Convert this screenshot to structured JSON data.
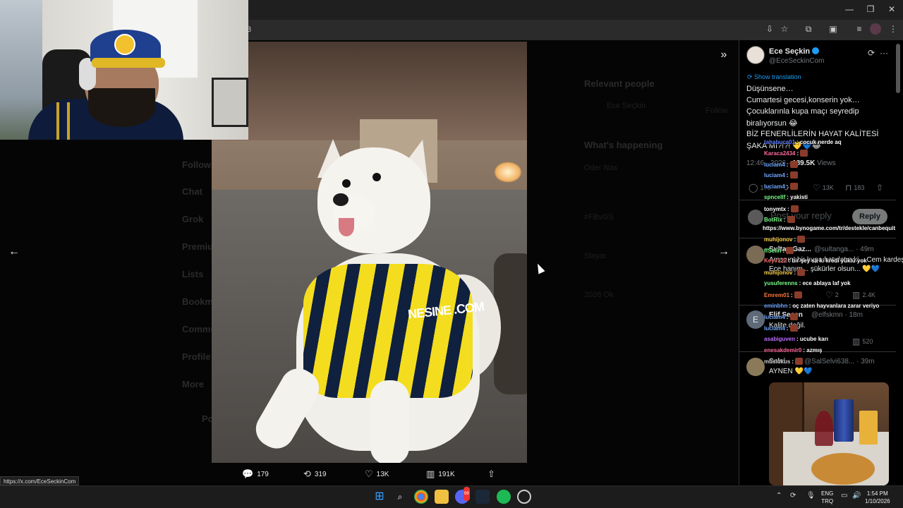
{
  "browser": {
    "address_fragment": "3",
    "status_url": "https://x.com/EceSeckinCom",
    "window_controls": {
      "minimize": "—",
      "restore": "❐",
      "close": "✕"
    }
  },
  "background_page": {
    "nav_items": [
      "Follow",
      "Chat",
      "Grok",
      "Premium",
      "Lists",
      "Bookmarks",
      "Communities",
      "Profile",
      "More"
    ],
    "post_label": "Post",
    "relevant_people": "Relevant people",
    "relevant_person": "Ece Seçkin",
    "follow_label": "Follow",
    "whats_happening": "What's happening",
    "trends": [
      "Oder Nas",
      "#FBvGS",
      "Slayar",
      "2026 Ok"
    ]
  },
  "media": {
    "jersey_text": "NESINE .COM",
    "stats": {
      "replies": "179",
      "reposts": "319",
      "likes": "13K",
      "views": "191K"
    }
  },
  "panel": {
    "author": {
      "name": "Ece Seçkin",
      "handle": "@EceSeckinCom"
    },
    "show_translation": "Show translation",
    "tweet_lines": [
      "Düşünsene…",
      "Cumartesi gecesi,konserin yok…",
      "Çocuklarınla kupa maçı seyredip",
      "biralıyorsun 😂",
      "BİZ FENERLİLERİN HAYAT KALİTESİ",
      "ŞAKA MI?!?! 💛💙😂"
    ],
    "meta": {
      "time": "12:46",
      "date": "2026",
      "views_count": "189.5K",
      "views_label": "Views"
    },
    "actions": {
      "replies": "179",
      "likes": "13K",
      "bookmarks": "183"
    },
    "reply_placeholder": "Post your reply",
    "reply_button": "Reply",
    "replies": [
      {
        "name": "Sultan Gaz...",
        "handle": "@sultanga...",
        "time": "· 49m",
        "lines": [
          "Amanın! bir kupa hatırlatın ki... Cem kardeşim",
          "Ece hanım... şükürler olsun... 💛💙"
        ],
        "likes": "2",
        "views": "2.4K"
      },
      {
        "name": "Elif Seçen",
        "handle": "@elfskmn",
        "time": "· 18m",
        "lines": [
          "Kalite değil."
        ],
        "views": "520"
      },
      {
        "name": "Selvi",
        "handle": "@SalSelvi638...",
        "time": "· 39m",
        "lines": [
          "AYNEN 💛💙"
        ]
      }
    ]
  },
  "chat": [
    {
      "user": "tahabuca01",
      "color": "#5b7cff",
      "msg": "cocuk nerde aq"
    },
    {
      "user": "Karaca2434",
      "color": "#ff6b9a",
      "msg": ""
    },
    {
      "user": "luciam4",
      "color": "#6fa8ff",
      "msg": ""
    },
    {
      "user": "luciam4",
      "color": "#6fa8ff",
      "msg": ""
    },
    {
      "user": "luciam4",
      "color": "#6fa8ff",
      "msg": ""
    },
    {
      "user": "spncellf",
      "color": "#7bff8a",
      "msg": "yakisti"
    },
    {
      "user": "tonymtx",
      "color": "#ffffff",
      "msg": ""
    },
    {
      "user": "BotRix",
      "color": "#7bff8a",
      "msg": ""
    },
    {
      "user": "",
      "color": "#ffffff",
      "msg": "https://www.bynogame.com/tr/destekle/canbequit"
    },
    {
      "user": "muhijonov",
      "color": "#ffd24a",
      "msg": ""
    },
    {
      "user": "ffSelin",
      "color": "#7bff8a",
      "msg": ""
    },
    {
      "user": "Keyv122",
      "color": "#ff6b6b",
      "msg": "bir şey sa ki kredi yüklü yok"
    },
    {
      "user": "muhijonov",
      "color": "#ffd24a",
      "msg": ""
    },
    {
      "user": "yusuferenns",
      "color": "#7bff8a",
      "msg": "ece ablaya laf yok"
    },
    {
      "user": "Emrem01",
      "color": "#ff7a3a",
      "msg": ""
    },
    {
      "user": "eminbhn",
      "color": "#6fa8ff",
      "msg": "oç zaten hayvanlara zarar veriyo"
    },
    {
      "user": "luciam4",
      "color": "#6fa8ff",
      "msg": ""
    },
    {
      "user": "luciam4",
      "color": "#6fa8ff",
      "msg": ""
    },
    {
      "user": "asabiguven",
      "color": "#c06bff",
      "msg": "ucube karı"
    },
    {
      "user": "enesakdemir0",
      "color": "#ff6b9a",
      "msg": "azmış"
    },
    {
      "user": "muslukus",
      "color": "#cccccc",
      "msg": ""
    }
  ],
  "taskbar": {
    "lang_top": "ENG",
    "lang_bottom": "TRQ",
    "time": "1:54 PM",
    "date": "1/10/2026",
    "discord_badge": "99"
  }
}
